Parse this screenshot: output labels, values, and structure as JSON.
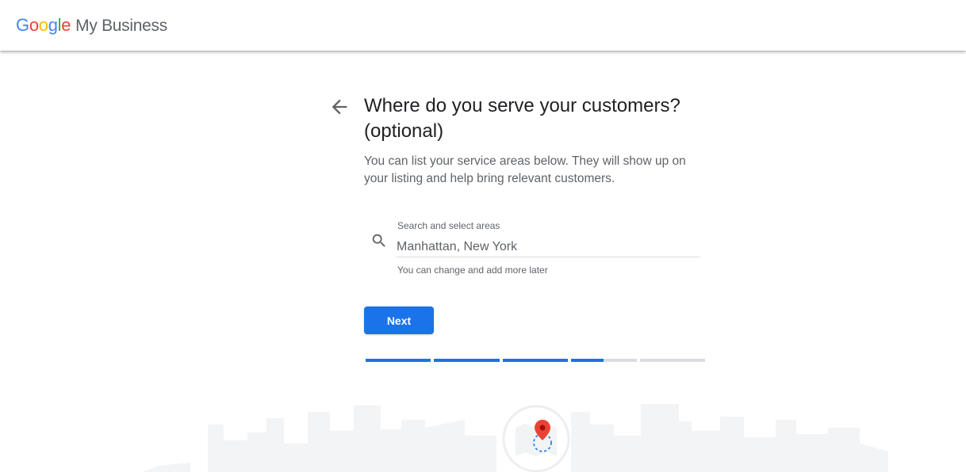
{
  "header": {
    "brand_letters": [
      "G",
      "o",
      "o",
      "g",
      "l",
      "e"
    ],
    "product": "My Business"
  },
  "page": {
    "title": "Where do you serve your customers? (optional)",
    "subtitle": "You can list your service areas below. They will show up on your listing and help bring relevant customers."
  },
  "search": {
    "label": "Search and select areas",
    "placeholder": "Manhattan, New York",
    "value": "",
    "helper": "You can change and add more later"
  },
  "actions": {
    "next_label": "Next"
  },
  "progress": {
    "steps": 5,
    "segment_fill": [
      1,
      1,
      1,
      0.5,
      0
    ]
  },
  "colors": {
    "accent": "#1a73e8",
    "track": "#dadce0",
    "pin": "#ea4335"
  },
  "icons": {
    "back": "arrow-back-icon",
    "search": "search-icon",
    "illustration": "map-pin-icon"
  }
}
